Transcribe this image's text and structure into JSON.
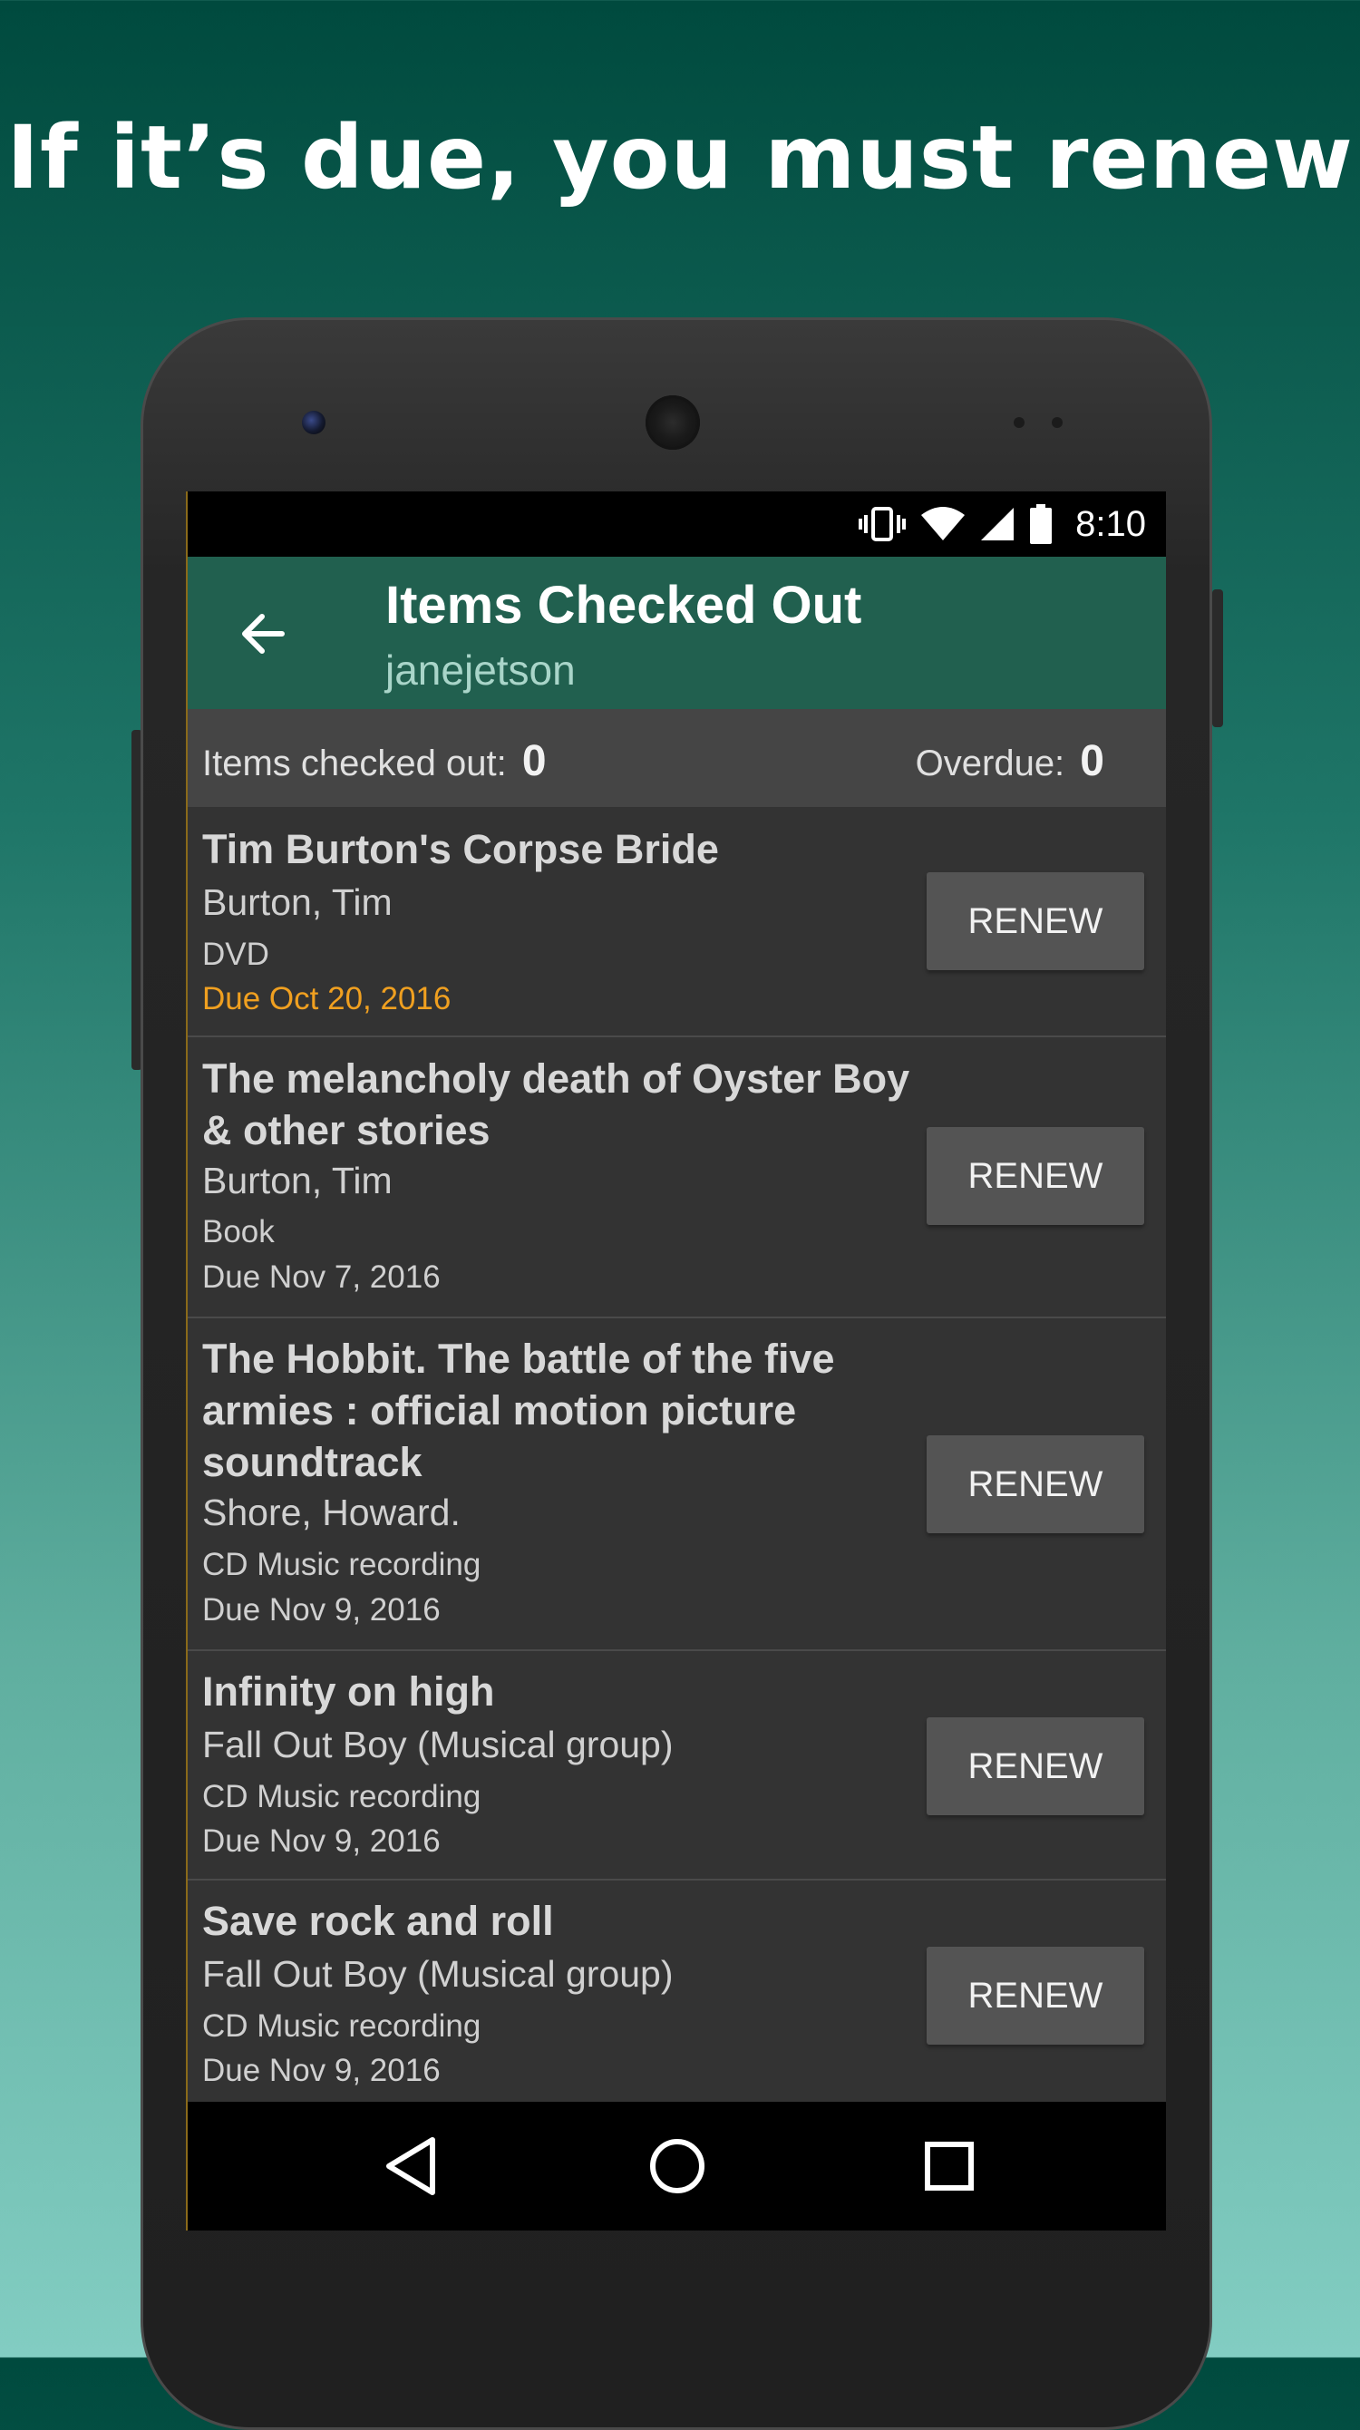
{
  "promo": {
    "headline": "If it’s due, you must renew"
  },
  "status_bar": {
    "time": "8:10",
    "icons": [
      "vibrate-icon",
      "wifi-icon",
      "signal-icon",
      "battery-icon"
    ]
  },
  "app_bar": {
    "title": "Items Checked Out",
    "subtitle": "janejetson",
    "back_icon": "arrow-back-icon"
  },
  "summary": {
    "checked_out_label": "Items checked out:",
    "checked_out_value": "0",
    "overdue_label": "Overdue:",
    "overdue_value": "0"
  },
  "items": [
    {
      "title_lines": [
        "Tim Burton's Corpse Bride"
      ],
      "author": "Burton, Tim",
      "format": "DVD",
      "due": "Due Oct 20, 2016",
      "due_highlight": true,
      "button": "RENEW"
    },
    {
      "title_lines": [
        "The melancholy death of Oyster Boy",
        "& other stories"
      ],
      "author": "Burton, Tim",
      "format": "Book",
      "due": "Due Nov 7, 2016",
      "due_highlight": false,
      "button": "RENEW"
    },
    {
      "title_lines": [
        "The Hobbit. The battle of the five",
        "armies : official motion picture",
        "soundtrack"
      ],
      "author": "Shore, Howard.",
      "format": "CD Music recording",
      "due": "Due Nov 9, 2016",
      "due_highlight": false,
      "button": "RENEW"
    },
    {
      "title_lines": [
        "Infinity on high"
      ],
      "author": "Fall Out Boy (Musical group)",
      "format": "CD Music recording",
      "due": "Due Nov 9, 2016",
      "due_highlight": false,
      "button": "RENEW"
    },
    {
      "title_lines": [
        "Save rock and roll"
      ],
      "author": "Fall Out Boy (Musical group)",
      "format": "CD Music recording",
      "due": "Due Nov 9, 2016",
      "due_highlight": false,
      "button": "RENEW"
    }
  ],
  "nav_bar": {
    "icons": [
      "back-triangle-icon",
      "home-circle-icon",
      "recents-square-icon"
    ]
  },
  "colors": {
    "app_bar": "#21604f",
    "overdue_due": "#f0a020",
    "list_bg": "#333333",
    "button_bg": "#545454"
  }
}
